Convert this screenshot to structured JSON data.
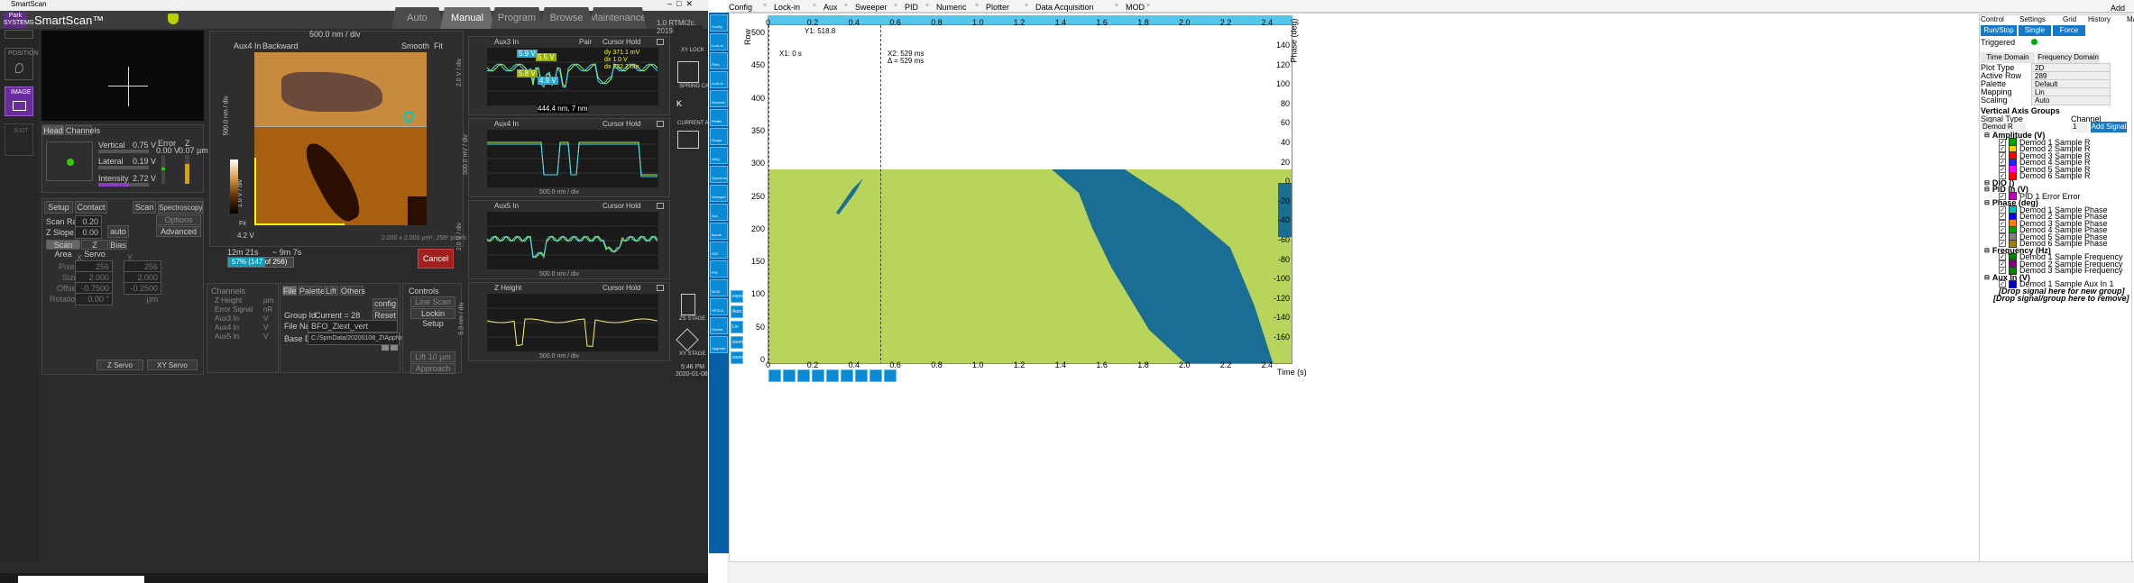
{
  "smartscan": {
    "title": "SmartScan",
    "app_name": "SmartScan™",
    "brand": "Park SYSTEMS",
    "tabs": [
      "Auto",
      "Manual",
      "Program",
      "Browse",
      "Maintenance"
    ],
    "status": "1.0 RTM(2c, 2019-",
    "nav": {
      "position": "POSITION",
      "image": "IMAGE",
      "exit": "EXIT"
    },
    "head_tabs": [
      "Head",
      "Channels"
    ],
    "head": {
      "vertical_label": "Vertical",
      "vertical_val": "0.75 V",
      "lateral_label": "Lateral",
      "lateral_val": "0.19 V",
      "intensity_label": "Intensity",
      "intensity_val": "2.72 V",
      "error_label": "Error",
      "error_val": "0.00 V",
      "z_label": "Z",
      "z_val": "0.07 µm"
    },
    "setup_tabs": [
      "Setup",
      "Contact",
      "Scan",
      "Spectroscopy"
    ],
    "scan": {
      "rate_label": "Scan Rate",
      "rate_val": "0.20 Hz",
      "zslope_label": "Z Slope",
      "zslope_val": "0.00",
      "auto": "auto",
      "options": "Options",
      "advanced": "Advanced"
    },
    "area_tabs": [
      "Scan Area",
      "Z Servo",
      "Bias"
    ],
    "area": {
      "x": "X",
      "y": "Y",
      "pixels": "Pixels",
      "px_x": "256",
      "px_y": "256",
      "size": "Size",
      "size_x": "2.000 µm",
      "size_y": "2.000 µm",
      "offset": "Offset",
      "off_x": "-0.7500 µm",
      "off_y": "-0.2500 µm",
      "rotation": "Rotation",
      "rot": "0.00 °"
    },
    "servo": [
      "Z Servo",
      "XY Servo"
    ],
    "image": {
      "channel": "Aux4 In",
      "direction": "Backward",
      "scale_top": "500.0 nm / div",
      "smooth": "Smooth",
      "fit": "Fit",
      "y_axis": "500.0 nm / div",
      "cb_axis": "1.0 V / div",
      "cb_val": "4.2 V",
      "fit2": "Fit",
      "footer": "2.000 x 2.000 µm², 256² pixels"
    },
    "progress": {
      "elapsed": "12m 21s",
      "remain": "~ 9m 7s",
      "text": "57% (147 of 256)",
      "pct": 57,
      "cancel": "Cancel"
    },
    "channels": {
      "title": "Channels",
      "items": [
        {
          "name": "Z Height",
          "unit": "µm"
        },
        {
          "name": "Error Signal",
          "unit": "nR"
        },
        {
          "name": "Aux3 In",
          "unit": "V"
        },
        {
          "name": "Aux4 In",
          "unit": "V"
        },
        {
          "name": "Aux5 In",
          "unit": "V"
        }
      ]
    },
    "file": {
      "tabs": [
        "File",
        "Palette",
        "Lift",
        "Others"
      ],
      "group_label": "Group Id",
      "group_val": "Current = 28",
      "config": "config",
      "reset": "Reset",
      "name_label": "File Name",
      "name_val": "BFO_Zlext_vert",
      "dir_label": "Base Dir",
      "dir_val": "C:/SpmData/20200108_ZIAppNote"
    },
    "controls": {
      "title": "Controls",
      "line_scan": "Line Scan",
      "lockin": "Lockin Setup",
      "lift": "Lift 10 µm",
      "approach": "Approach"
    },
    "plots": [
      {
        "title": "Aux3 In",
        "y": "2.0 V / div",
        "x": "500.0 nm / div",
        "opts": [
          "Pair",
          "Cursor",
          "Hold"
        ],
        "tags": [
          "5.9 V",
          "5.5 V",
          "5.8 V",
          "4.9 V"
        ],
        "dy": "dy  371.1 mV",
        "dx": "dx     1.0 V",
        "dx2": "dx  222.2 nm",
        "cursor": "444.4 nm, 7 nm"
      },
      {
        "title": "Aux4 In",
        "y": "500.0 mV / div",
        "x": "500.0 nm / div",
        "opts": [
          "Cursor",
          "Hold"
        ]
      },
      {
        "title": "Aux5 In",
        "y": "2.0 V / div",
        "x": "500.0 nm / div",
        "opts": [
          "Cursor",
          "Hold"
        ]
      },
      {
        "title": "Z Height",
        "y": "5.0 nm / div",
        "x": "500.0 nm / div",
        "opts": [
          "Cursor",
          "Hold"
        ]
      }
    ],
    "side": {
      "xy_lock": "XY LOCK",
      "spring": "SPRING CA",
      "k": "K",
      "current": "CURRENT AM",
      "zs": "ZS STAGE",
      "xy": "XY STAGE",
      "time": "5:46 PM",
      "date": "2020-01-08"
    }
  },
  "lab": {
    "top_tabs": [
      "Config",
      "Lock-in",
      "Aux",
      "Sweeper",
      "PID",
      "Numeric",
      "Plotter",
      "Data Acquisition",
      "MOD"
    ],
    "add_row": "Add Row",
    "left_icons": [
      "Config",
      "Lock-in",
      "Files",
      "Lock-in",
      "Numeric",
      "Plotter",
      "Scope",
      "DAQ",
      "Spectrum",
      "Sweeper",
      "Aux",
      "Inputs",
      "DIO",
      "PID",
      "MOD",
      "HF2CA",
      "Device",
      "Upgrade"
    ],
    "plot": {
      "y_axis": "Row",
      "y2_axis": "Phase (deg)",
      "x_axis": "Time (s)",
      "x_ticks": [
        "0",
        "0.2",
        "0.4",
        "0.6",
        "0.8",
        "1.0",
        "1.2",
        "1.4",
        "1.6",
        "1.8",
        "2.0",
        "2.2",
        "2.4"
      ],
      "y_ticks": [
        "500",
        "450",
        "400",
        "350",
        "300",
        "250",
        "200",
        "150",
        "100",
        "50",
        "0"
      ],
      "y2_ticks": [
        "140",
        "120",
        "100",
        "80",
        "60",
        "40",
        "20",
        "0",
        "-20",
        "-40",
        "-60",
        "-80",
        "-100",
        "-120",
        "-140",
        "-160"
      ],
      "y1_label": "Y1: 518.8",
      "x1": "X1: 0 s",
      "x2": "X2: 529 ms",
      "dx": "Δ = 529 ms"
    },
    "bottom_icons": [
      "zoom-in",
      "zoom-out",
      "Lin",
      "FS",
      "cursor",
      "measure",
      "math",
      "chart",
      "expand"
    ],
    "side_icons": [
      "export",
      "Auto",
      "Lin",
      "zoom-in",
      "zoom-out"
    ],
    "right": {
      "tabs": [
        "Control",
        "Settings",
        "Grid",
        "History",
        "Math"
      ],
      "buttons": [
        "Run/Stop",
        "Single",
        "Force"
      ],
      "triggered": "Triggered",
      "domain_tabs": [
        "Time Domain",
        "Frequency Domain"
      ],
      "rows": [
        {
          "k": "Plot Type",
          "v": "2D"
        },
        {
          "k": "Active Row",
          "v": "289"
        },
        {
          "k": "Palette",
          "v": "Default"
        },
        {
          "k": "Mapping",
          "v": "Lin"
        },
        {
          "k": "Scaling",
          "v": "Auto"
        }
      ],
      "vag": "Vertical Axis Groups",
      "sig_type": "Signal Type",
      "channel": "Channel",
      "sig_val": "Demod R",
      "ch_val": "1",
      "add_signal": "Add Signal",
      "groups": [
        {
          "name": "Amplitude (V)",
          "items": [
            {
              "t": "Demod 1 Sample R",
              "c": "#00a000"
            },
            {
              "t": "Demod 2 Sample R",
              "c": "#ffd000"
            },
            {
              "t": "Demod 3 Sample R",
              "c": "#ff0000"
            },
            {
              "t": "Demod 4 Sample R",
              "c": "#2020ff"
            },
            {
              "t": "Demod 5 Sample R",
              "c": "#ff00ff"
            },
            {
              "t": "Demod 6 Sample R",
              "c": "#ff0000"
            }
          ]
        },
        {
          "name": "DIO ()",
          "items": []
        },
        {
          "name": "PID In (V)",
          "items": [
            {
              "t": "PID 1 Error Error",
              "c": "#c000c0"
            }
          ]
        },
        {
          "name": "Phase (deg)",
          "items": [
            {
              "t": "Demod 1 Sample Phase",
              "c": "#00c0c0"
            },
            {
              "t": "Demod 2 Sample Phase",
              "c": "#0000ff"
            },
            {
              "t": "Demod 3 Sample Phase",
              "c": "#ff8000"
            },
            {
              "t": "Demod 4 Sample Phase",
              "c": "#00a000"
            },
            {
              "t": "Demod 5 Sample Phase",
              "c": "#808080"
            },
            {
              "t": "Demod 6 Sample Phase",
              "c": "#a08000"
            }
          ]
        },
        {
          "name": "Frequency (Hz)",
          "items": [
            {
              "t": "Demod 1 Sample Frequency",
              "c": "#008000"
            },
            {
              "t": "Demod 2 Sample Frequency",
              "c": "#800080"
            },
            {
              "t": "Demod 3 Sample Frequency",
              "c": "#008000"
            }
          ]
        },
        {
          "name": "Aux In (V)",
          "items": [
            {
              "t": "Demod 1 Sample Aux In 1",
              "c": "#0000c0"
            }
          ]
        }
      ],
      "drop1": "[Drop signal here for new group]",
      "drop2": "[Drop signal/group here to remove]"
    }
  }
}
